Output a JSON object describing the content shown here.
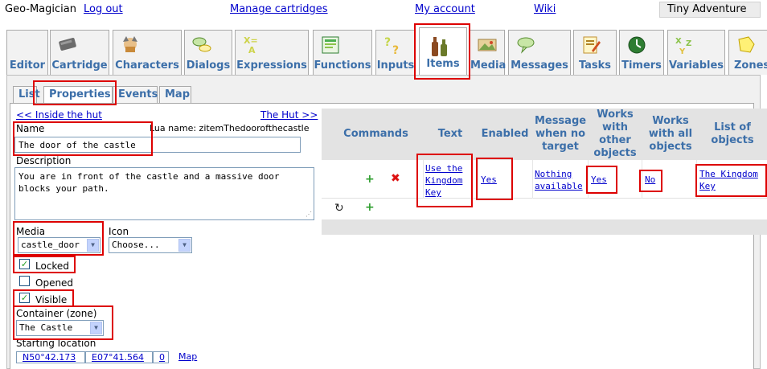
{
  "topbar": {
    "brand": "Geo-Magician",
    "logout": "Log out",
    "manage": "Manage cartridges",
    "account": "My account",
    "wiki": "Wiki",
    "project": "Tiny Adventure"
  },
  "main_tabs": [
    {
      "label": "Editor",
      "icon": "editor-icon"
    },
    {
      "label": "Cartridge",
      "icon": "cartridge-icon"
    },
    {
      "label": "Characters",
      "icon": "characters-icon"
    },
    {
      "label": "Dialogs",
      "icon": "dialogs-icon"
    },
    {
      "label": "Expressions",
      "icon": "expressions-icon"
    },
    {
      "label": "Functions",
      "icon": "functions-icon"
    },
    {
      "label": "Inputs",
      "icon": "inputs-icon"
    },
    {
      "label": "Items",
      "icon": "items-icon"
    },
    {
      "label": "Media",
      "icon": "media-icon"
    },
    {
      "label": "Messages",
      "icon": "messages-icon"
    },
    {
      "label": "Tasks",
      "icon": "tasks-icon"
    },
    {
      "label": "Timers",
      "icon": "timers-icon"
    },
    {
      "label": "Variables",
      "icon": "variables-icon"
    },
    {
      "label": "Zones",
      "icon": "zones-icon"
    }
  ],
  "active_main_tab": "Items",
  "sub_tabs": [
    "List",
    "Properties",
    "Events",
    "Map"
  ],
  "active_sub_tab": "Properties",
  "nav": {
    "prev": "<< Inside the hut",
    "next": "The Hut >>"
  },
  "form": {
    "name_label": "Name",
    "lua_name": "Lua name: zitemThedoorofthecastle",
    "name_value": "The door of the castle",
    "description_label": "Description",
    "description_value": "You are in front of the castle and a massive door blocks your path.",
    "media_label": "Media",
    "media_value": "castle_door",
    "icon_label": "Icon",
    "icon_value": "Choose...",
    "locked_label": "Locked",
    "locked_checked": true,
    "opened_label": "Opened",
    "opened_checked": false,
    "visible_label": "Visible",
    "visible_checked": true,
    "container_label": "Container (zone)",
    "container_value": "The Castle",
    "start_label": "Starting location",
    "lat": "N50°42.173",
    "lon": "E07°41.564",
    "alt": "0",
    "map_link": "Map"
  },
  "commands_grid": {
    "headers": [
      "Commands",
      "Text",
      "Enabled",
      "Message when no target",
      "Works with other objects",
      "Works with all objects",
      "List of objects"
    ],
    "rows": [
      {
        "text": "Use the Kingdom Key",
        "enabled": "Yes",
        "message": "Nothing available",
        "works_other": "Yes",
        "works_all": "No",
        "objects": "The Kingdom Key"
      }
    ]
  },
  "colors": {
    "accent": "#3c6fa9",
    "link": "#0000cc",
    "highlight": "#dd0000"
  }
}
